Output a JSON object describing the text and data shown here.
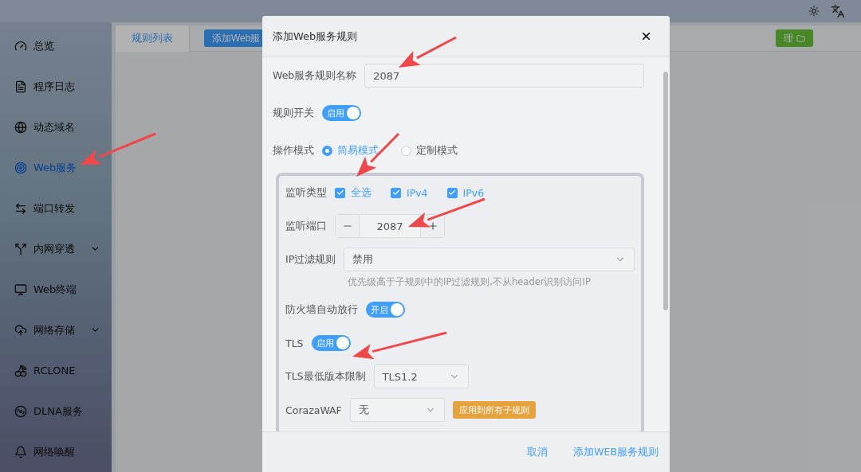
{
  "sidebar": {
    "items": [
      {
        "label": "总览",
        "selected": false,
        "has_submenu": false
      },
      {
        "label": "程序日志",
        "selected": false,
        "has_submenu": false
      },
      {
        "label": "动态域名",
        "selected": false,
        "has_submenu": false
      },
      {
        "label": "Web服务",
        "selected": true,
        "has_submenu": false
      },
      {
        "label": "端口转发",
        "selected": false,
        "has_submenu": false
      },
      {
        "label": "内网穿透",
        "selected": false,
        "has_submenu": true
      },
      {
        "label": "Web终端",
        "selected": false,
        "has_submenu": false
      },
      {
        "label": "网络存储",
        "selected": false,
        "has_submenu": true
      },
      {
        "label": "RCLONE",
        "selected": false,
        "has_submenu": false
      },
      {
        "label": "DLNA服务",
        "selected": false,
        "has_submenu": false
      },
      {
        "label": "网络唤醒",
        "selected": false,
        "has_submenu": false
      }
    ]
  },
  "tabs": [
    {
      "label": "规则列表",
      "selected": true
    }
  ],
  "toolbar_buttons": [
    {
      "label": "添加Web服",
      "kind": "primary"
    },
    {
      "label": "理",
      "kind": "success"
    }
  ],
  "dialog": {
    "title": "添加Web服务规则",
    "fields": [
      {
        "kind": "text",
        "label": "Web服务规则名称",
        "value": "2087"
      },
      {
        "kind": "switch",
        "label": "规则开关",
        "on": true,
        "text": "启用"
      },
      {
        "kind": "radio",
        "label": "操作模式",
        "options": [
          {
            "label": "简易模式",
            "selected": true
          },
          {
            "label": "定制模式",
            "selected": false
          }
        ]
      }
    ],
    "panel_fields": [
      {
        "kind": "checkboxes",
        "label": "监听类型",
        "options": [
          {
            "label": "全选",
            "checked": true
          },
          {
            "label": "IPv4",
            "checked": true
          },
          {
            "label": "IPv6",
            "checked": true
          }
        ]
      },
      {
        "kind": "number",
        "label": "监听端口",
        "value": "2087"
      },
      {
        "kind": "select",
        "label": "IP过滤规则",
        "value": "禁用",
        "hint": "优先级高于子规则中的IP过滤规则,不从header识别访问IP"
      },
      {
        "kind": "switch",
        "label": "防火墙自动放行",
        "on": true,
        "text": "开启"
      },
      {
        "kind": "switch",
        "label": "TLS",
        "on": true,
        "text": "启用"
      },
      {
        "kind": "select_short",
        "label": "TLS最低版本限制",
        "value": "TLS1.2"
      },
      {
        "kind": "select_short",
        "label": "CorazaWAF",
        "value": "无",
        "action": "应用到所有子规则"
      }
    ],
    "buttons": [
      "取消",
      "添加WEB服务规则"
    ]
  }
}
